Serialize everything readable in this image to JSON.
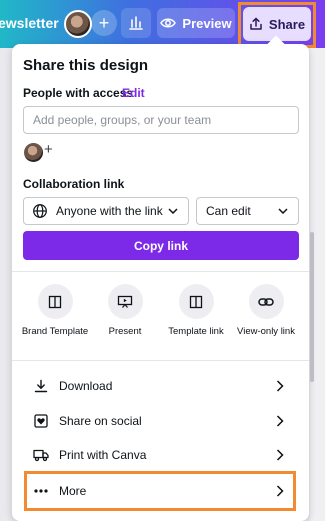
{
  "topbar": {
    "doc_title": "ewsletter",
    "preview_label": "Preview",
    "share_label": "Share"
  },
  "panel": {
    "title": "Share this design",
    "people_label": "People with access",
    "edit_label": "Edit",
    "people_input": {
      "placeholder": "Add people, groups, or your team",
      "value": ""
    },
    "collab_label": "Collaboration link",
    "access_select": "Anyone with the link",
    "permission_select": "Can edit",
    "copy_link_label": "Copy link",
    "options": [
      {
        "label": "Brand Template",
        "icon": "layout-icon"
      },
      {
        "label": "Present",
        "icon": "present-icon"
      },
      {
        "label": "Template link",
        "icon": "layout-icon"
      },
      {
        "label": "View-only link",
        "icon": "link-icon"
      }
    ],
    "rows": [
      {
        "label": "Download",
        "icon": "download-icon"
      },
      {
        "label": "Share on social",
        "icon": "heart-icon"
      },
      {
        "label": "Print with Canva",
        "icon": "truck-icon"
      },
      {
        "label": "More",
        "icon": "more-icon"
      }
    ]
  },
  "colors": {
    "accent": "#7d2ae8",
    "highlight": "#f28a30",
    "share_button_bg": "#e7ddff"
  }
}
